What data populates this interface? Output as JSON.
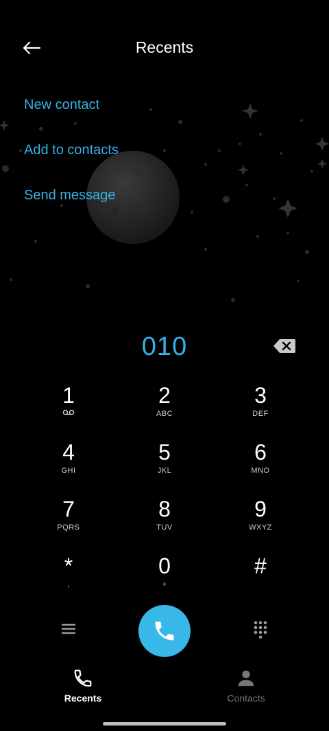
{
  "header": {
    "title": "Recents",
    "back_icon": "arrow-left-icon"
  },
  "actions": [
    "New contact",
    "Add to contacts",
    "Send message"
  ],
  "dialer": {
    "number": "010",
    "backspace_icon": "backspace-icon"
  },
  "keypad": [
    {
      "digit": "1",
      "letters": ""
    },
    {
      "digit": "2",
      "letters": "ABC"
    },
    {
      "digit": "3",
      "letters": "DEF"
    },
    {
      "digit": "4",
      "letters": "GHI"
    },
    {
      "digit": "5",
      "letters": "JKL"
    },
    {
      "digit": "6",
      "letters": "MNO"
    },
    {
      "digit": "7",
      "letters": "PQRS"
    },
    {
      "digit": "8",
      "letters": "TUV"
    },
    {
      "digit": "9",
      "letters": "WXYZ"
    },
    {
      "digit": "*",
      "letters": ","
    },
    {
      "digit": "0",
      "letters": "+"
    },
    {
      "digit": "#",
      "letters": ""
    }
  ],
  "controls": {
    "menu_icon": "menu-icon",
    "call_icon": "phone-icon",
    "dialpad_icon": "dialpad-icon"
  },
  "nav": {
    "recents": {
      "label": "Recents",
      "icon": "phone-icon"
    },
    "contacts": {
      "label": "Contacts",
      "icon": "person-icon"
    }
  },
  "colors": {
    "accent": "#37b2e6",
    "background": "#000000",
    "inactive": "#777777"
  }
}
